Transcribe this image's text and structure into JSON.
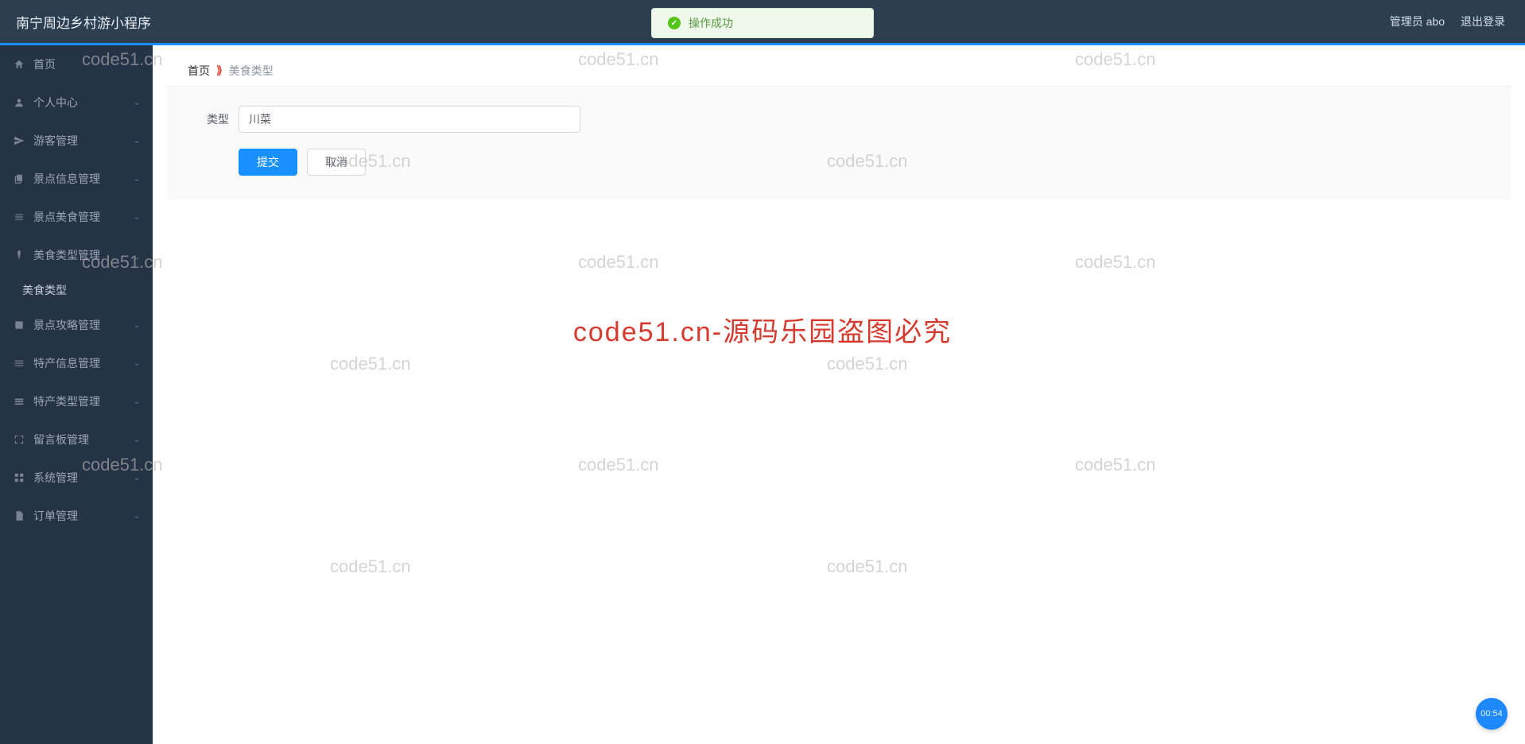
{
  "header": {
    "title": "南宁周边乡村游小程序",
    "admin_label": "管理员 abo",
    "logout_label": "退出登录"
  },
  "toast": {
    "text": "操作成功"
  },
  "sidebar": {
    "items": [
      {
        "label": "首页",
        "icon": "home",
        "arrow": false
      },
      {
        "label": "个人中心",
        "icon": "user",
        "arrow": true
      },
      {
        "label": "游客管理",
        "icon": "send",
        "arrow": true
      },
      {
        "label": "景点信息管理",
        "icon": "copy",
        "arrow": true
      },
      {
        "label": "景点美食管理",
        "icon": "list",
        "arrow": true
      },
      {
        "label": "美食类型管理",
        "icon": "tag",
        "arrow": true,
        "open": true
      },
      {
        "label": "景点攻略管理",
        "icon": "book",
        "arrow": true
      },
      {
        "label": "特产信息管理",
        "icon": "menu",
        "arrow": true
      },
      {
        "label": "特产类型管理",
        "icon": "layers",
        "arrow": true
      },
      {
        "label": "留言板管理",
        "icon": "expand",
        "arrow": true
      },
      {
        "label": "系统管理",
        "icon": "grid",
        "arrow": true
      },
      {
        "label": "订单管理",
        "icon": "file",
        "arrow": true
      }
    ],
    "submenu_label": "美食类型"
  },
  "breadcrumb": {
    "home": "首页",
    "current": "美食类型"
  },
  "form": {
    "type_label": "类型",
    "type_value": "川菜",
    "submit": "提交",
    "cancel": "取消"
  },
  "watermark": {
    "text": "code51.cn",
    "center": "code51.cn-源码乐园盗图必究"
  },
  "timer": "00:54"
}
